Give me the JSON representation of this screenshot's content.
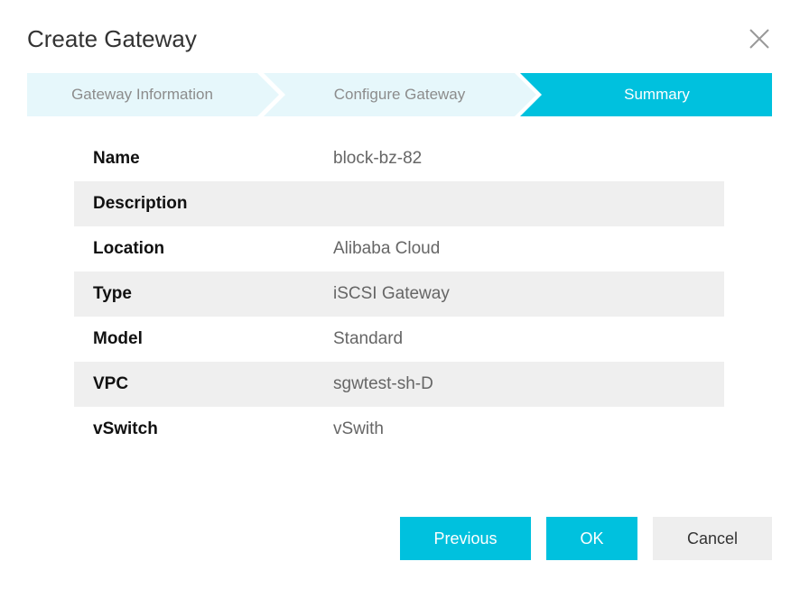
{
  "dialog": {
    "title": "Create Gateway"
  },
  "steps": [
    {
      "label": "Gateway Information",
      "state": "done"
    },
    {
      "label": "Configure Gateway",
      "state": "done"
    },
    {
      "label": "Summary",
      "state": "active"
    }
  ],
  "summary": {
    "rows": [
      {
        "label": "Name",
        "value": "block-bz-82"
      },
      {
        "label": "Description",
        "value": ""
      },
      {
        "label": "Location",
        "value": "Alibaba Cloud"
      },
      {
        "label": "Type",
        "value": "iSCSI Gateway"
      },
      {
        "label": "Model",
        "value": "Standard"
      },
      {
        "label": "VPC",
        "value": "sgwtest-sh-D"
      },
      {
        "label": "vSwitch",
        "value": "vSwith"
      }
    ]
  },
  "buttons": {
    "previous": "Previous",
    "ok": "OK",
    "cancel": "Cancel"
  },
  "colors": {
    "accent": "#00c1de",
    "step_inactive_bg": "#e6f7fb",
    "row_alt_bg": "#efefef"
  },
  "icons": {
    "close": "close-icon"
  }
}
